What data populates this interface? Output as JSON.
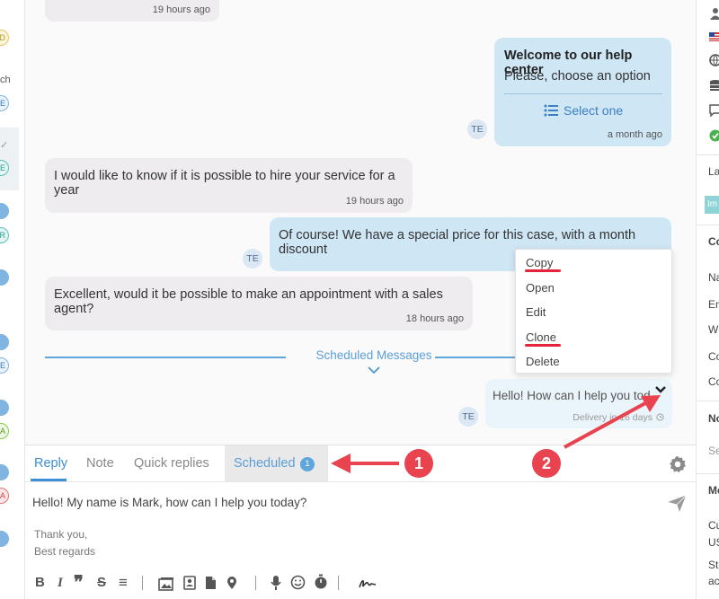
{
  "left_sidebar": {
    "texts": [
      "ch",
      "ch"
    ],
    "avatar_letters": [
      "D",
      "E",
      "E",
      "R",
      "E",
      "A",
      "A"
    ],
    "check_mark": "✓"
  },
  "chat": {
    "messages": [
      {
        "id": "m0",
        "text": "",
        "time": "19 hours ago"
      },
      {
        "id": "m1",
        "title": "Welcome to our help center",
        "text": "Please, choose an option",
        "button_label": "Select one",
        "time": "a month ago",
        "avatar": "TE"
      },
      {
        "id": "m2",
        "text": "I would like to know if it is possible to hire your service for a year",
        "time": "19 hours ago"
      },
      {
        "id": "m3",
        "text": "Of course! We have a special price for this case, with a month discount",
        "avatar": "TE"
      },
      {
        "id": "m4",
        "text": "Excellent, would it be possible to make an appointment with a sales agent?",
        "time": "18 hours ago"
      },
      {
        "id": "m5",
        "text": "Hello! How can I help you tod",
        "delivery": "Delivery in 16 days",
        "avatar": "TE"
      }
    ],
    "scheduled_label": "Scheduled Messages"
  },
  "context_menu": {
    "items": [
      "Copy",
      "Open",
      "Edit",
      "Clone",
      "Delete"
    ]
  },
  "composer": {
    "tabs": [
      "Reply",
      "Note",
      "Quick replies",
      "Scheduled"
    ],
    "scheduled_count": "1",
    "message": "Hello! My name is Mark, how can I help you today?",
    "signature": [
      "Thank you,",
      "Best regards"
    ],
    "toolbar_glyphs": {
      "bold": "B",
      "italic": "I",
      "quote": "❞",
      "strike": "S",
      "align": "≡",
      "signature": "~"
    }
  },
  "right_sidebar": {
    "section_texts": [
      "La",
      "Im",
      "Co",
      "Na",
      "Em",
      "Wh",
      "Co",
      "Co",
      "No",
      "Se",
      "Me",
      "Cu",
      "US",
      "St",
      "ac"
    ]
  },
  "annotations": {
    "badge1": "1",
    "badge2": "2"
  },
  "colors": {
    "accent": "#3d8ed6",
    "annotation": "#e8434f",
    "outgoing_bubble": "#cfe6f5",
    "incoming_bubble": "#eeecef"
  }
}
